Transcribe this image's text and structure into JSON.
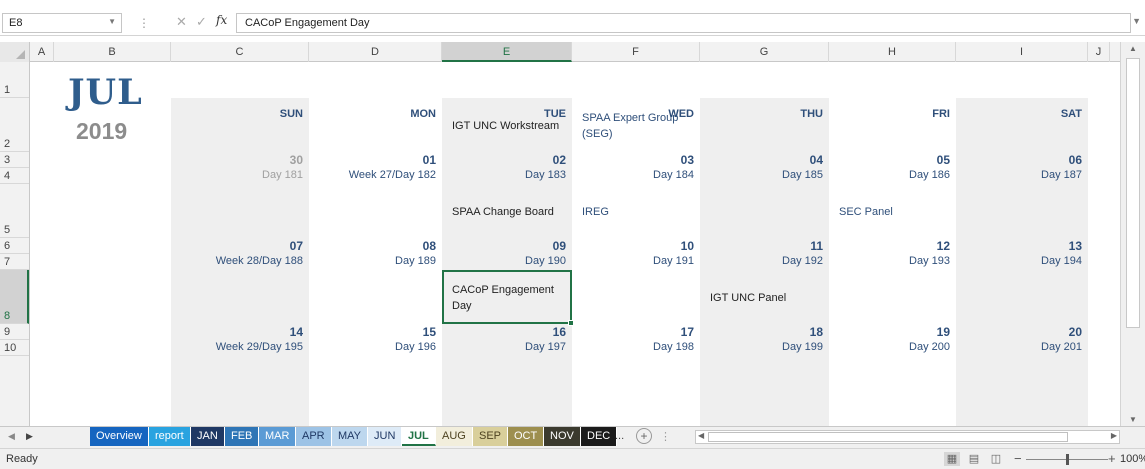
{
  "formula_bar": {
    "name_box": "E8",
    "formula": "CACoP Engagement Day"
  },
  "columns": [
    "A",
    "B",
    "C",
    "D",
    "E",
    "F",
    "G",
    "H",
    "I",
    "J"
  ],
  "rows": [
    "1",
    "2",
    "3",
    "4",
    "5",
    "6",
    "7",
    "8",
    "9",
    "10"
  ],
  "calendar": {
    "month": "JUL",
    "year": "2019",
    "days_of_week": [
      "SUN",
      "MON",
      "TUE",
      "WED",
      "THU",
      "FRI",
      "SAT"
    ],
    "weeks": [
      {
        "events": [
          "",
          "",
          "IGT UNC Workstream",
          "SPAA Expert Group (SEG)",
          "",
          "",
          ""
        ],
        "dates": [
          "30",
          "01",
          "02",
          "03",
          "04",
          "05",
          "06"
        ],
        "labels": [
          "Day 181",
          "Week 27/Day 182",
          "Day 183",
          "Day 184",
          "Day 185",
          "Day 186",
          "Day 187"
        ]
      },
      {
        "events": [
          "",
          "",
          "SPAA Change Board",
          "IREG",
          "",
          "SEC Panel",
          ""
        ],
        "dates": [
          "07",
          "08",
          "09",
          "10",
          "11",
          "12",
          "13"
        ],
        "labels": [
          "Week 28/Day 188",
          "Day 189",
          "Day 190",
          "Day 191",
          "Day 192",
          "Day 193",
          "Day 194"
        ]
      },
      {
        "events": [
          "",
          "",
          "CACoP Engagement Day",
          "",
          "IGT UNC Panel",
          "",
          ""
        ],
        "dates": [
          "14",
          "15",
          "16",
          "17",
          "18",
          "19",
          "20"
        ],
        "labels": [
          "Week 29/Day 195",
          "Day 196",
          "Day 197",
          "Day 198",
          "Day 199",
          "Day 200",
          "Day 201"
        ]
      }
    ]
  },
  "sheet_tabs": [
    {
      "label": "Overview",
      "bg": "#1565c0",
      "fg": "#ffffff"
    },
    {
      "label": "report",
      "bg": "#29a3e0",
      "fg": "#ffffff"
    },
    {
      "label": "JAN",
      "bg": "#1f3864",
      "fg": "#ffffff"
    },
    {
      "label": "FEB",
      "bg": "#2e75b6",
      "fg": "#ffffff"
    },
    {
      "label": "MAR",
      "bg": "#5b9bd5",
      "fg": "#ffffff"
    },
    {
      "label": "APR",
      "bg": "#9dc3e6",
      "fg": "#1f3864"
    },
    {
      "label": "MAY",
      "bg": "#bdd7ee",
      "fg": "#1f3864"
    },
    {
      "label": "JUN",
      "bg": "#deebf7",
      "fg": "#1f3864"
    },
    {
      "label": "JUL",
      "bg": "#ffffff",
      "fg": "#217346"
    },
    {
      "label": "AUG",
      "bg": "#f2eedc",
      "fg": "#4d4220"
    },
    {
      "label": "SEP",
      "bg": "#d9cf9b",
      "fg": "#4d4220"
    },
    {
      "label": "OCT",
      "bg": "#9d8f4f",
      "fg": "#ffffff"
    },
    {
      "label": "NOV",
      "bg": "#3b3a2e",
      "fg": "#ffffff"
    },
    {
      "label": "DEC",
      "bg": "#1b1b1b",
      "fg": "#ffffff"
    }
  ],
  "active_tab": "JUL",
  "tab_more": "...",
  "status": "Ready",
  "zoom": "100%"
}
